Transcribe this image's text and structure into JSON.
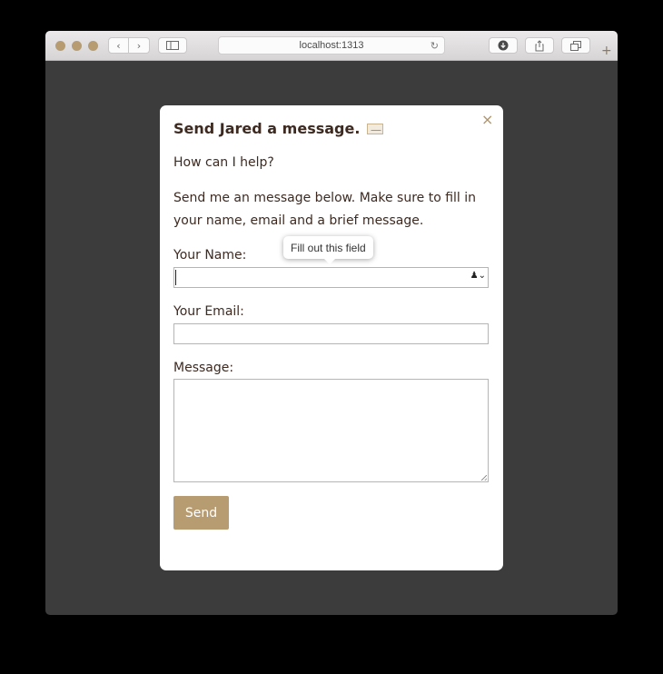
{
  "browser": {
    "address": "localhost:1313",
    "icons": [
      "close-dot",
      "minimize-dot",
      "zoom-dot",
      "back-arrow",
      "forward-arrow",
      "sidebar-icon",
      "reload-icon",
      "download-icon",
      "share-icon",
      "tabs-icon",
      "new-tab-plus"
    ]
  },
  "modal": {
    "title": "Send Jared a message.",
    "close": "×",
    "intro": "How can I help?",
    "description": "Send me an message below. Make sure to fill in your name, email and a brief message.",
    "name_label": "Your Name:",
    "email_label": "Your Email:",
    "message_label": "Message:",
    "name_value": "",
    "email_value": "",
    "message_value": "",
    "send_label": "Send",
    "tooltip": "Fill out this field"
  },
  "colors": {
    "accent": "#b79c72",
    "text": "#3d2a21",
    "backdrop": "#3c3c3c"
  }
}
